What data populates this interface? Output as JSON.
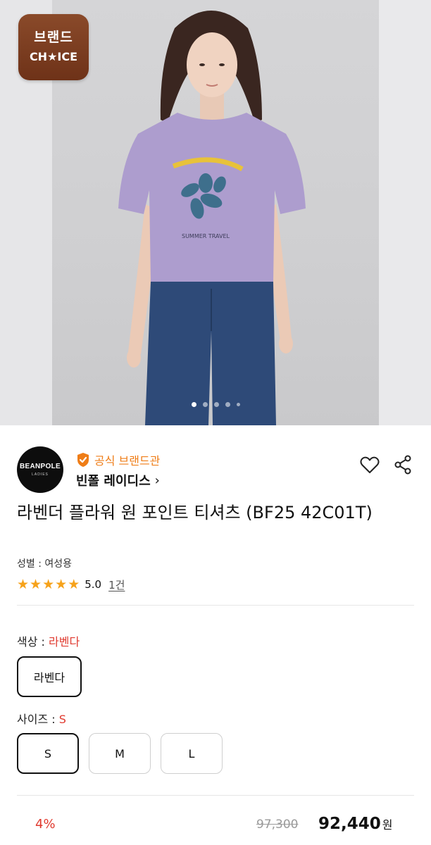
{
  "hero": {
    "badge_line1": "브랜드",
    "badge_line2": "CH★ICE",
    "shirt_text": "SUMMER TRAVEL",
    "shirt_color": "#ad9dce",
    "jeans_color": "#2e4a78",
    "carousel": {
      "count": 5,
      "active_index": 0
    }
  },
  "brand": {
    "logo_line1": "BEANPOLE",
    "logo_line2": "LADIES",
    "official_label": "공식 브랜드관",
    "name": "빈폴 레이디스",
    "name_chevron": "›"
  },
  "actions": {
    "wishlist_icon": "heart-icon",
    "share_icon": "share-icon"
  },
  "product": {
    "title": "라벤더 플라워 원 포인트 티셔츠 (BF25 42C01T)",
    "gender": "성별 : 여성용",
    "rating": {
      "stars": 5,
      "score": "5.0",
      "review_count": "1건"
    }
  },
  "options": {
    "color": {
      "label": "색상 : ",
      "selected": "라벤다",
      "choices": [
        "라벤다"
      ]
    },
    "size": {
      "label": "사이즈 : ",
      "selected": "S",
      "choices": [
        "S",
        "M",
        "L"
      ]
    }
  },
  "price": {
    "discount": "4%",
    "original": "97,300",
    "final": "92,440",
    "currency": "원"
  },
  "colors": {
    "accent_red": "#e03a2f",
    "official_orange": "#ef7d17",
    "star": "#f6a21a",
    "badge_brown": "#7a3c20"
  }
}
